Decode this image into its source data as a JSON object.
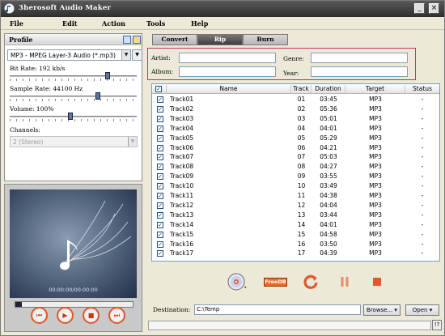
{
  "window": {
    "title": "3herosoft Audio Maker"
  },
  "menu": [
    "File",
    "Edit",
    "Action",
    "Tools",
    "Help"
  ],
  "profile": {
    "header": "Profile",
    "format": "MP3 - MPEG Layer-3 Audio  (*.mp3)",
    "bitrate_label": "Bit Rate: 192 kb/s",
    "bitrate_level": 0.78,
    "samplerate_label": "Sample Rate: 44100 Hz",
    "samplerate_level": 0.7,
    "volume_label": "Volume: 100%",
    "volume_level": 0.48,
    "channels_label": "Channels:",
    "channels_value": "2 (Stereo)"
  },
  "player": {
    "time": "00:00:00/00:00:00",
    "playback_position": 0
  },
  "tabs": [
    "Convert",
    "Rip",
    "Burn"
  ],
  "active_tab": "Rip",
  "info": {
    "artist_label": "Artist:",
    "album_label": "Album:",
    "genre_label": "Genre:",
    "year_label": "Year:"
  },
  "columns": [
    "Name",
    "Track",
    "Duration",
    "Target",
    "Status"
  ],
  "tracks": [
    {
      "name": "Track01",
      "track": "01",
      "duration": "03:45",
      "target": "MP3",
      "status": "-"
    },
    {
      "name": "Track02",
      "track": "02",
      "duration": "05:36",
      "target": "MP3",
      "status": "-"
    },
    {
      "name": "Track03",
      "track": "03",
      "duration": "05:01",
      "target": "MP3",
      "status": "-"
    },
    {
      "name": "Track04",
      "track": "04",
      "duration": "04:01",
      "target": "MP3",
      "status": "-"
    },
    {
      "name": "Track05",
      "track": "05",
      "duration": "05:29",
      "target": "MP3",
      "status": "-"
    },
    {
      "name": "Track06",
      "track": "06",
      "duration": "04:21",
      "target": "MP3",
      "status": "-"
    },
    {
      "name": "Track07",
      "track": "07",
      "duration": "05:03",
      "target": "MP3",
      "status": "-"
    },
    {
      "name": "Track08",
      "track": "08",
      "duration": "04:27",
      "target": "MP3",
      "status": "-"
    },
    {
      "name": "Track09",
      "track": "09",
      "duration": "03:55",
      "target": "MP3",
      "status": "-"
    },
    {
      "name": "Track10",
      "track": "10",
      "duration": "03:49",
      "target": "MP3",
      "status": "-"
    },
    {
      "name": "Track11",
      "track": "11",
      "duration": "04:38",
      "target": "MP3",
      "status": "-"
    },
    {
      "name": "Track12",
      "track": "12",
      "duration": "04:04",
      "target": "MP3",
      "status": "-"
    },
    {
      "name": "Track13",
      "track": "13",
      "duration": "03:44",
      "target": "MP3",
      "status": "-"
    },
    {
      "name": "Track14",
      "track": "14",
      "duration": "04:01",
      "target": "MP3",
      "status": "-"
    },
    {
      "name": "Track15",
      "track": "15",
      "duration": "04:58",
      "target": "MP3",
      "status": "-"
    },
    {
      "name": "Track16",
      "track": "16",
      "duration": "03:50",
      "target": "MP3",
      "status": "-"
    },
    {
      "name": "Track17",
      "track": "17",
      "duration": "04:39",
      "target": "MP3",
      "status": "-"
    }
  ],
  "actions": {
    "freedb": "FreeDB"
  },
  "destination": {
    "label": "Destination:",
    "path": "C:\\Temp",
    "browse": "Browse...",
    "open": "Open"
  },
  "help": "!?",
  "colors": {
    "accent": "#e05a2a",
    "highlight_border": "#c0365a",
    "title_bar": "#2e2e2e"
  }
}
